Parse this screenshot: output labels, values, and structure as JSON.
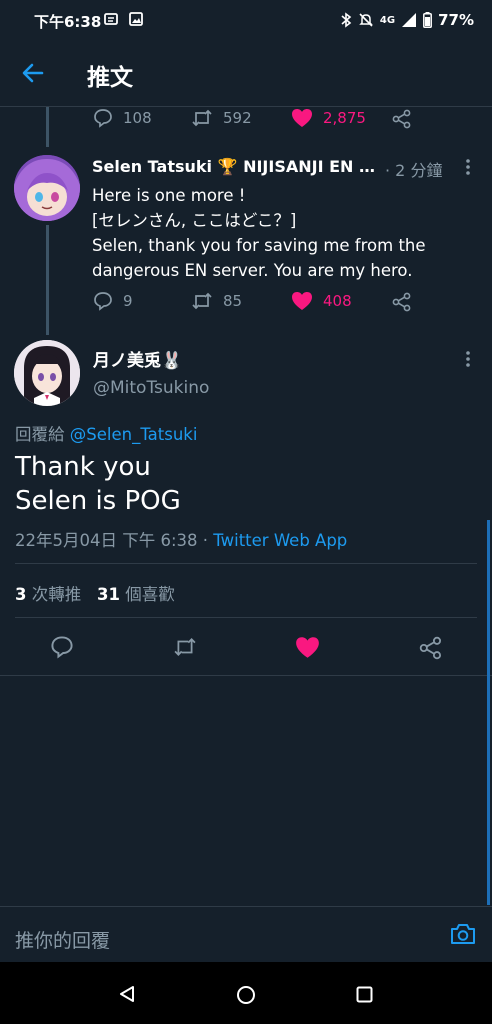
{
  "status_bar": {
    "time": "下午6:38",
    "network": "4G",
    "battery": "77%"
  },
  "header": {
    "title": "推文"
  },
  "prev_tweet": {
    "replies": "108",
    "retweets": "592",
    "likes": "2,875"
  },
  "tweet1": {
    "name": "Selen Tatsuki 🏆 NIJISANJI EN …",
    "time": "· 2 分鐘",
    "lines": [
      "Here is one more !",
      "[セレンさん, ここはどこ？]",
      "Selen, thank you for saving me from the",
      "dangerous EN server. You are my hero."
    ],
    "replies": "9",
    "retweets": "85",
    "likes": "408"
  },
  "main_tweet": {
    "name": "月ノ美兎🐰",
    "handle": "@MitoTsukino",
    "reply_to_label": "回覆給",
    "reply_to_user": "@Selen_Tatsuki",
    "text_lines": [
      "Thank you",
      "Selen is POG"
    ],
    "timestamp": "22年5月04日 下午 6:38 ·",
    "source": "Twitter Web App",
    "retweet_count": "3",
    "retweet_label": "次轉推",
    "like_count": "31",
    "like_label": "個喜歡"
  },
  "reply_box": {
    "placeholder": "推你的回覆"
  },
  "colors": {
    "background": "#15202b",
    "accent": "#1d9bf0",
    "like": "#f91880",
    "muted": "#8899a6"
  }
}
